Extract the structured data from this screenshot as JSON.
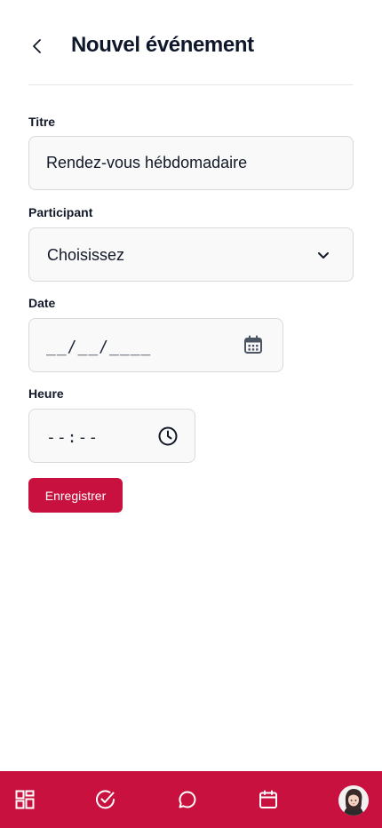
{
  "header": {
    "title": "Nouvel événement",
    "back_icon": "chevron-left-icon"
  },
  "form": {
    "title_label": "Titre",
    "title_value": "Rendez-vous hébdomadaire",
    "participant_label": "Participant",
    "participant_value": "Choisissez",
    "date_label": "Date",
    "date_placeholder": "__/__/____",
    "time_label": "Heure",
    "time_placeholder": "--:--",
    "save_label": "Enregistrer"
  },
  "bottom_nav": {
    "items": [
      {
        "icon": "dashboard-grid-icon"
      },
      {
        "icon": "check-circle-icon"
      },
      {
        "icon": "chat-bubble-icon"
      },
      {
        "icon": "calendar-icon"
      },
      {
        "icon": "avatar"
      }
    ]
  },
  "colors": {
    "accent": "#c8113e",
    "field_bg": "#f9f9f9",
    "field_border": "#d9d9d9"
  }
}
